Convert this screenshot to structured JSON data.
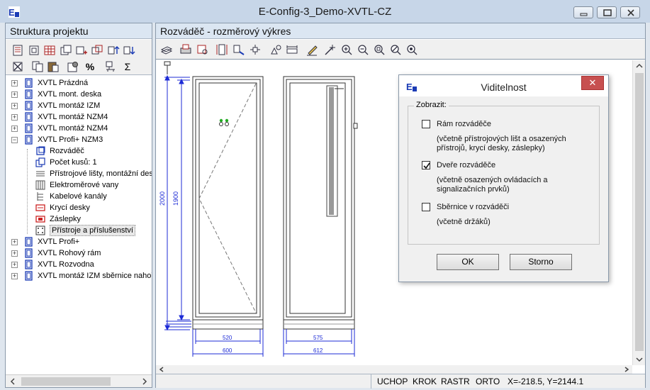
{
  "window": {
    "title": "E-Config-3_Demo-XVTL-CZ"
  },
  "left_pane": {
    "header": "Struktura projektu",
    "tree": [
      {
        "label": "XVTL Prázdná",
        "expander": "+"
      },
      {
        "label": "XVTL mont. deska",
        "expander": "+"
      },
      {
        "label": "XVTL montáž IZM",
        "expander": "+"
      },
      {
        "label": "XVTL montáž NZM4",
        "expander": "+"
      },
      {
        "label": "XVTL montáž NZM4",
        "expander": "+"
      },
      {
        "label": "XVTL Profi+ NZM3",
        "expander": "−"
      },
      {
        "label": "Rozváděč"
      },
      {
        "label": "Počet kusů: 1"
      },
      {
        "label": "Přístrojové lišty, montážní des"
      },
      {
        "label": "Elektroměrové vany"
      },
      {
        "label": "Kabelové kanály"
      },
      {
        "label": "Krycí desky"
      },
      {
        "label": "Záslepky"
      },
      {
        "label": "Přístroje a příslušenství"
      },
      {
        "label": "XVTL Profi+",
        "expander": "+"
      },
      {
        "label": "XVTL Rohový rám",
        "expander": "+"
      },
      {
        "label": "XVTL Rozvodna",
        "expander": "+"
      },
      {
        "label": "XVTL montáž IZM sběrnice nahoř",
        "expander": "+"
      }
    ],
    "toolbar_percent": "%",
    "toolbar_sigma": "Σ"
  },
  "right_pane": {
    "header": "Rozváděč - rozměrový výkres"
  },
  "drawing": {
    "dim_height_outer": "2000",
    "dim_height_inner": "1900",
    "dim_width_front_inner": "520",
    "dim_width_front_outer": "600",
    "dim_width_side_inner": "575",
    "dim_width_side_outer": "612"
  },
  "status": {
    "uchop": "UCHOP",
    "krok": "KROK",
    "rastr": "RASTR",
    "orto": "ORTO",
    "coords": "X=-218.5, Y=2144.1"
  },
  "dialog": {
    "title": "Viditelnost",
    "close": "✕",
    "group_label": "Zobrazit:",
    "options": [
      {
        "label": "Rám rozváděče",
        "checked": false,
        "desc": [
          "(včetně přístrojových lišt a osazených",
          "přístrojů, krycí desky, záslepky)"
        ]
      },
      {
        "label": "Dveře rozváděče",
        "checked": true,
        "desc": [
          "(včetně osazených ovládacích a",
          "signalizačních prvků)"
        ]
      },
      {
        "label": "Sběrnice v rozváděči",
        "checked": false,
        "desc": [
          "(včetně držáků)"
        ]
      }
    ],
    "ok": "OK",
    "cancel": "Storno"
  },
  "colors": {
    "accent": "#1b1bd8",
    "dim": "#1d2bd6"
  }
}
